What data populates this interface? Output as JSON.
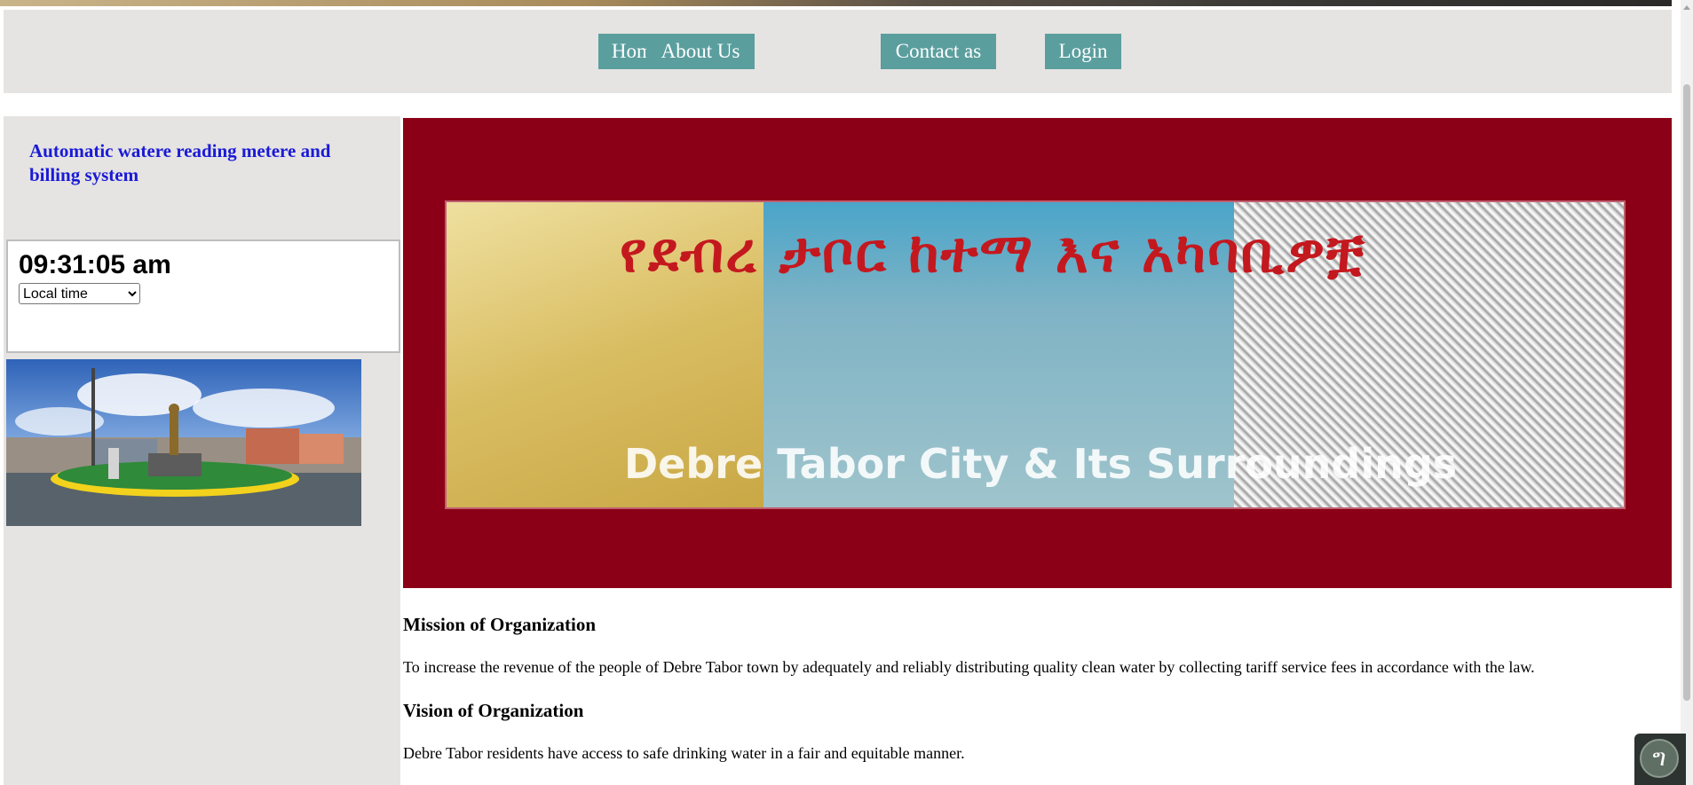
{
  "nav": {
    "items": [
      {
        "label": "Home"
      },
      {
        "label": "About Us"
      },
      {
        "label": "Contact as"
      },
      {
        "label": "Login"
      }
    ]
  },
  "sidebar": {
    "title": "Automatic watere reading metere and billing system",
    "clock": {
      "time": "09:31:05 am",
      "timezone_selected": "Local time"
    }
  },
  "banner": {
    "amharic_title": "የደብረ ታቦር ከተማ እና አካባቢዎቿ",
    "caption": "Debre Tabor City & Its Surroundings"
  },
  "main": {
    "mission_heading": "Mission of Organization",
    "mission_text": "To increase the revenue of the people of Debre Tabor town by adequately and reliably distributing quality clean water by collecting tariff service fees in accordance with the law.",
    "vision_heading": "Vision of Organization",
    "vision_text": "Debre Tabor residents have access to safe drinking water in a fair and equitable manner."
  },
  "widget": {
    "icon_glyph": "ግ"
  }
}
